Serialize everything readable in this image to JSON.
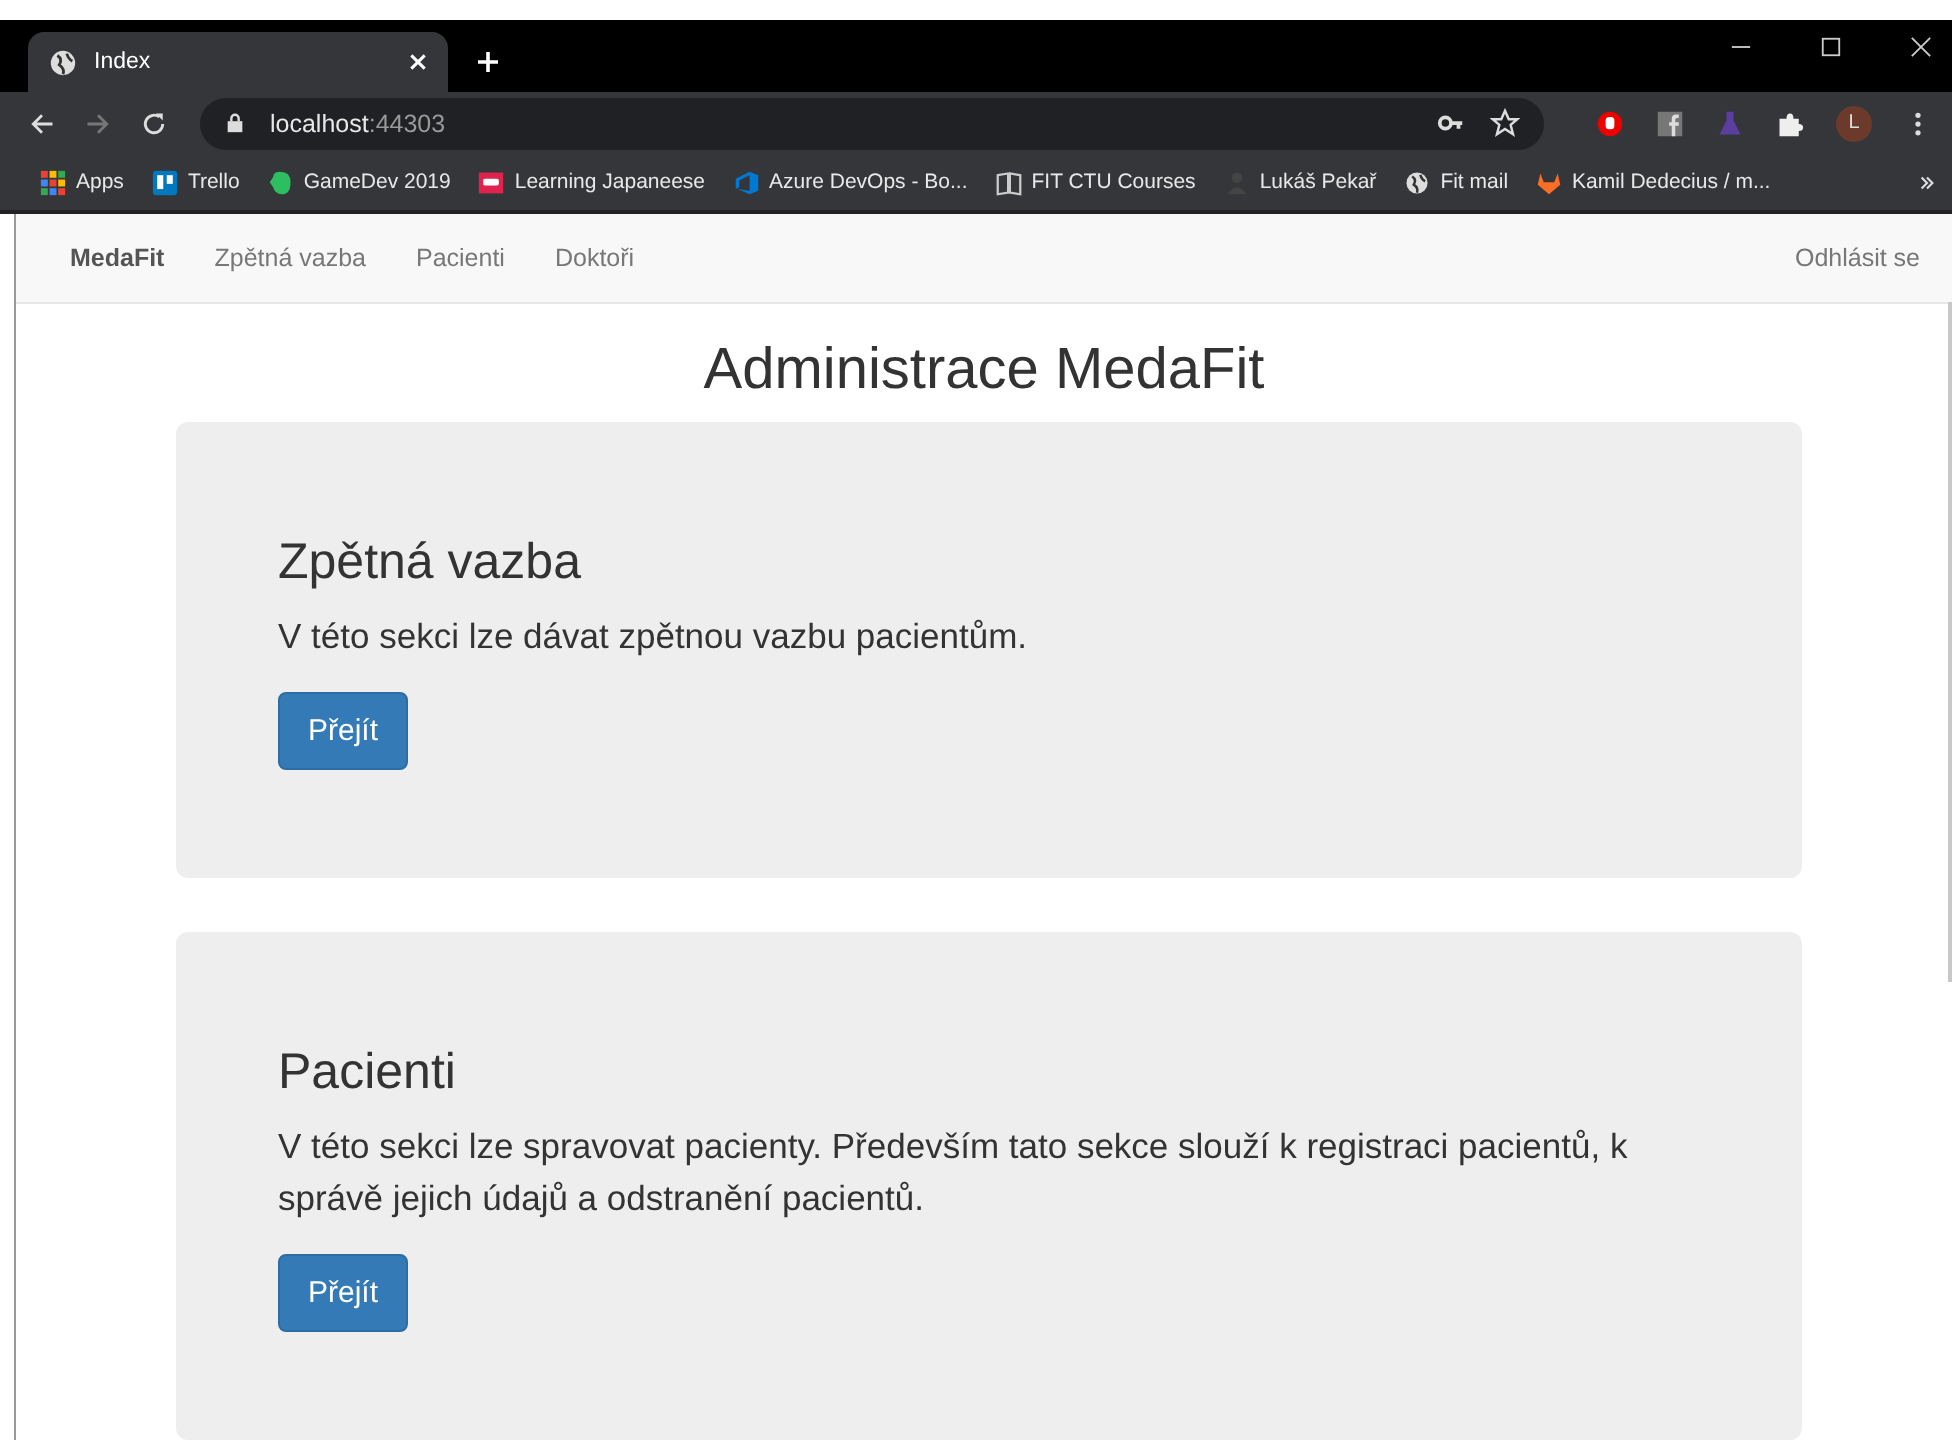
{
  "browser": {
    "tab": {
      "title": "Index",
      "selected": true
    },
    "address": {
      "host": "localhost",
      "port": ":44303"
    },
    "profile_initial": "L",
    "bookmarks": [
      {
        "label": "Apps",
        "kind": "grid"
      },
      {
        "label": "Trello",
        "kind": "board"
      },
      {
        "label": "GameDev 2019",
        "kind": "leaf"
      },
      {
        "label": "Learning Japaneese",
        "kind": "red"
      },
      {
        "label": "Azure DevOps - Bo...",
        "kind": "azure"
      },
      {
        "label": "FIT CTU Courses",
        "kind": "book"
      },
      {
        "label": "Lukáš Pekař",
        "kind": "person"
      },
      {
        "label": "Fit mail",
        "kind": "globe"
      },
      {
        "label": "Kamil Dedecius / m...",
        "kind": "fox"
      }
    ]
  },
  "navbar": {
    "brand": "MedaFit",
    "links": [
      "Zpětná vazba",
      "Pacienti",
      "Doktoři"
    ],
    "logout": "Odhlásit se"
  },
  "page_title": "Administrace MedaFit",
  "sections": [
    {
      "heading": "Zpětná vazba",
      "text": "V této sekci lze dávat zpětnou vazbu pacientům.",
      "button": "Přejít"
    },
    {
      "heading": "Pacienti",
      "text": "V této sekci lze spravovat pacienty. Především tato sekce slouží k registraci pacientů, k správě jejich údajů a odstranění pacientů.",
      "button": "Přejít"
    }
  ]
}
